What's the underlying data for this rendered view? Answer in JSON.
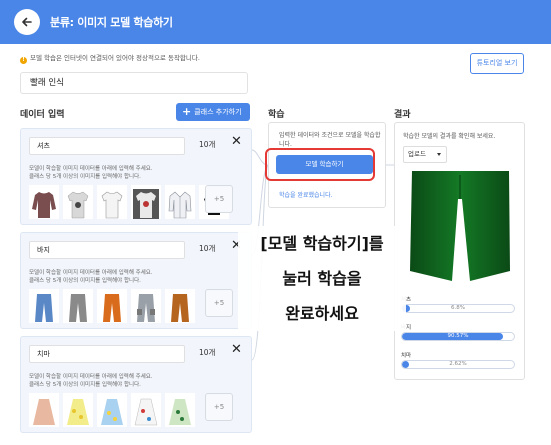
{
  "header": {
    "title": "분류: 이미지 모델 학습하기"
  },
  "notice": {
    "icon": "warning-icon",
    "text": "모델 학습은 인터넷이 연결되어 있어야 정상적으로 동작합니다."
  },
  "tutorial_button": "튜토리얼 보기",
  "project_name": "빨래 인식",
  "data_input": {
    "heading": "데이터 입력",
    "add_class_label": "클래스 추가하기",
    "classes": [
      {
        "name": "셔츠",
        "count": "10개",
        "help_line1": "모델이 학습할 이미지 데이터를 아래에 입력해 주세요.",
        "help_line2": "클래스 당 5개 이상의 이미지를 입력해야 합니다.",
        "more": "+5"
      },
      {
        "name": "바지",
        "count": "10개",
        "help_line1": "모델이 학습할 이미지 데이터를 아래에 입력해 주세요.",
        "help_line2": "클래스 당 5개 이상의 이미지를 입력해야 합니다.",
        "more": "+5"
      },
      {
        "name": "치마",
        "count": "10개",
        "help_line1": "모델이 학습할 이미지 데이터를 아래에 입력해 주세요.",
        "help_line2": "클래스 당 5개 이상의 이미지를 입력해야 합니다.",
        "more": "+5"
      }
    ]
  },
  "training": {
    "heading": "학습",
    "description": "입력한 데이터와 조건으로 모델을 학습합니다.",
    "button": "모델 학습하기",
    "done_text": "학습을 완료했습니다.",
    "highlight_color": "#e53935"
  },
  "overlay": {
    "line1": "[모델 학습하기]를",
    "line2": "눌러 학습을",
    "line3": "완료하세요"
  },
  "result": {
    "heading": "결과",
    "description": "학습한 모델의 결과를 확인해 보세요.",
    "upload_label": "업로드",
    "probabilities": [
      {
        "label": "셔츠",
        "value": "6.8%",
        "fraction": 0.068
      },
      {
        "label": "바지",
        "value": "90.57%",
        "fraction": 0.9057
      },
      {
        "label": "치마",
        "value": "2.62%",
        "fraction": 0.0262
      }
    ]
  },
  "colors": {
    "accent": "#4a86e8",
    "highlight": "#e53935",
    "pants": "#0f5a1c"
  }
}
